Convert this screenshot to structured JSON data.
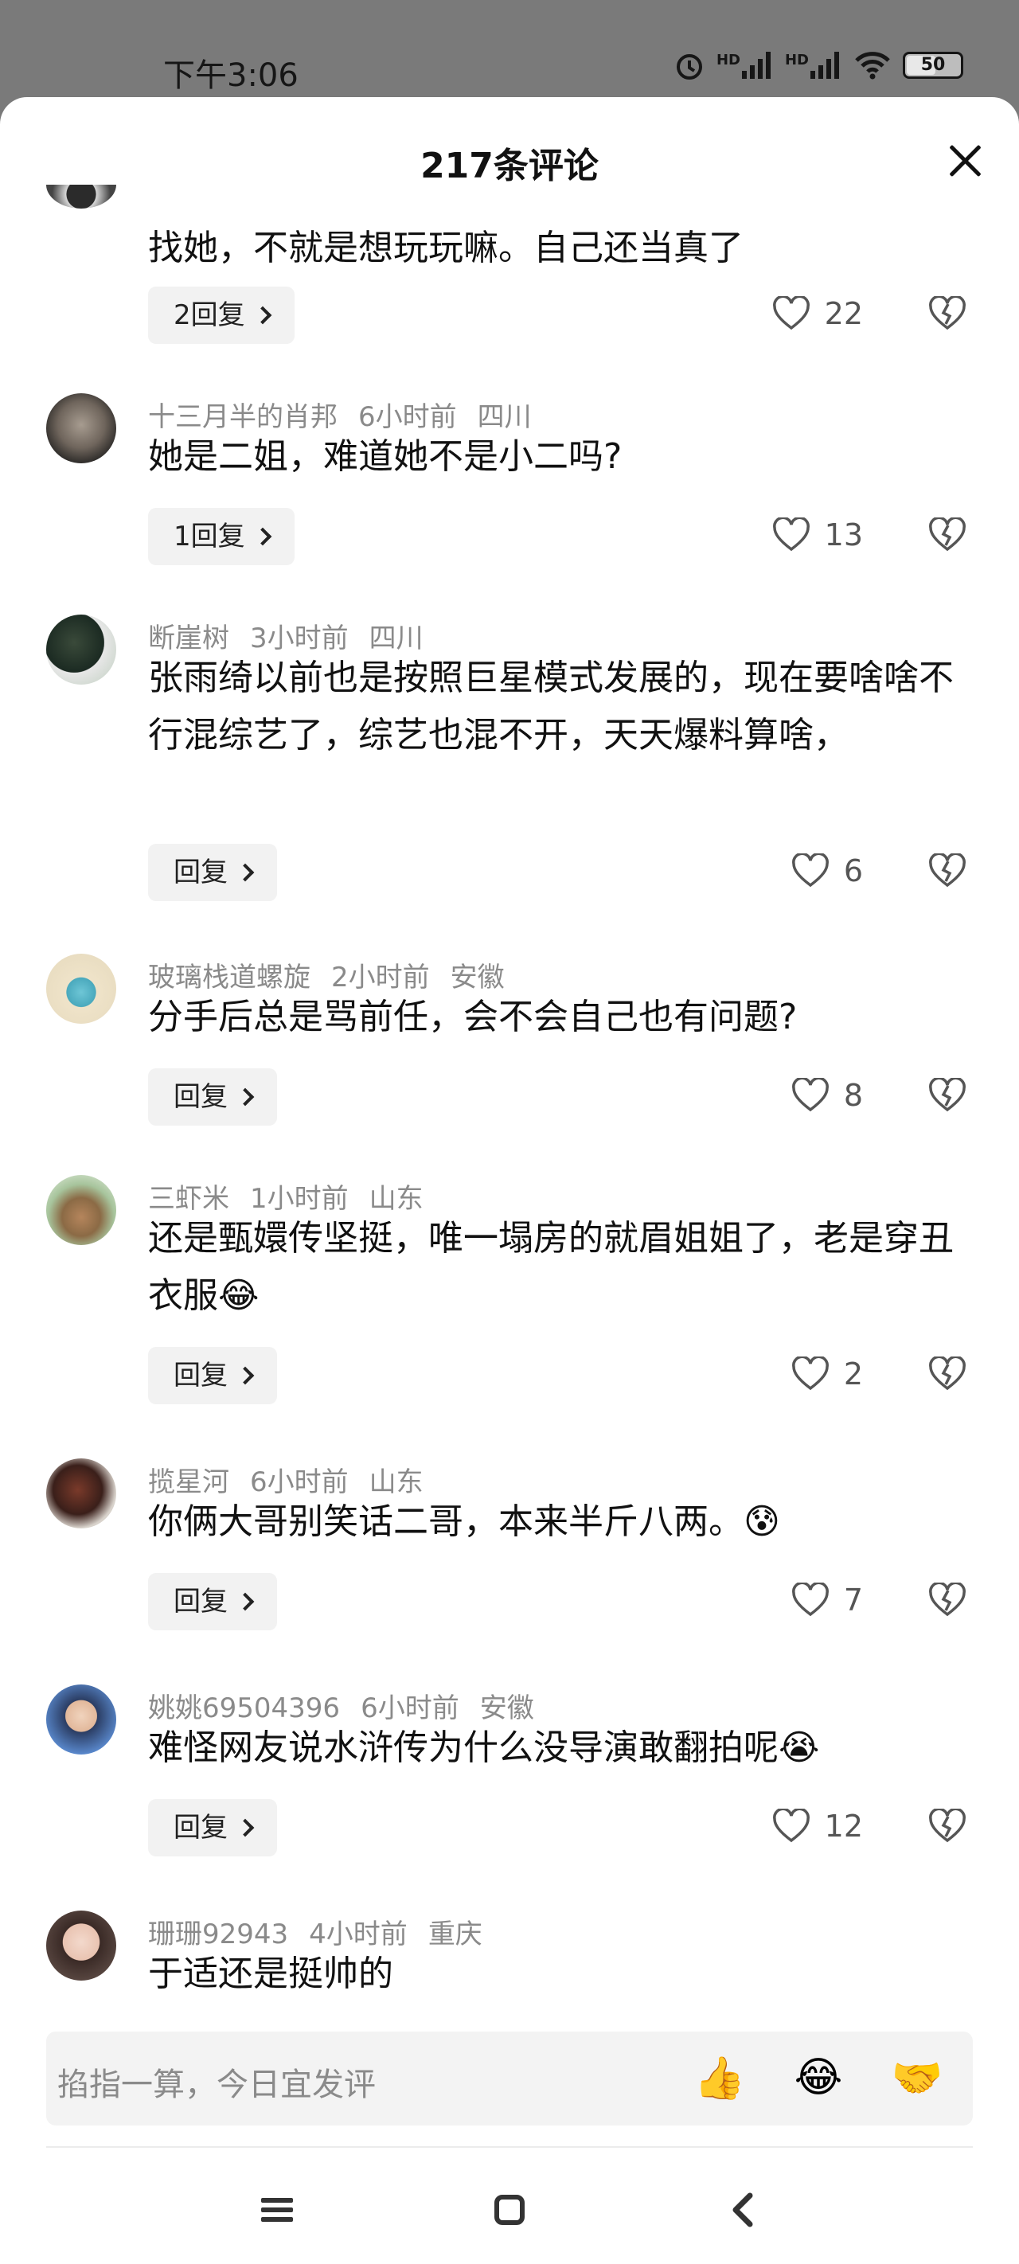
{
  "status_bar": {
    "time": "下午3:06",
    "battery": "50",
    "network_1": "HD",
    "network_2": "HD"
  },
  "header": {
    "title": "217条评论",
    "close_icon": "close-icon"
  },
  "colors": {
    "meta_text": "#8a8a8a",
    "reply_bg": "#f2f2f2",
    "sheet_bg": "#ffffff",
    "status_bg": "#7a7a7a"
  },
  "comments": [
    {
      "user": "",
      "time": "",
      "location": "",
      "text": "找她，不就是想玩玩嘛。自己还当真了",
      "reply_label": "2回复",
      "likes": "22"
    },
    {
      "user": "十三月半的肖邦",
      "time": "6小时前",
      "location": "四川",
      "text": "她是二姐，难道她不是小二吗?",
      "reply_label": "1回复",
      "likes": "13"
    },
    {
      "user": "断崖树",
      "time": "3小时前",
      "location": "四川",
      "text": "张雨绮以前也是按照巨星模式发展的，现在要啥啥不行混综艺了，综艺也混不开，天天爆料算啥，",
      "reply_label": "回复",
      "likes": "6"
    },
    {
      "user": "玻璃栈道螺旋",
      "time": "2小时前",
      "location": "安徽",
      "text": "分手后总是骂前任，会不会自己也有问题?",
      "reply_label": "回复",
      "likes": "8"
    },
    {
      "user": "三虾米",
      "time": "1小时前",
      "location": "山东",
      "text": "还是甄嬛传坚挺，唯一塌房的就眉姐姐了，老是穿丑衣服😂",
      "reply_label": "回复",
      "likes": "2"
    },
    {
      "user": "揽星河",
      "time": "6小时前",
      "location": "山东",
      "text": "你俩大哥别笑话二哥，本来半斤八两。😰",
      "reply_label": "回复",
      "likes": "7"
    },
    {
      "user": "姚姚69504396",
      "time": "6小时前",
      "location": "安徽",
      "text": "难怪网友说水浒传为什么没导演敢翻拍呢😭",
      "reply_label": "回复",
      "likes": "12"
    },
    {
      "user": "珊珊92943",
      "time": "4小时前",
      "location": "重庆",
      "text": "于适还是挺帅的",
      "reply_label": "",
      "likes": ""
    }
  ],
  "input_bar": {
    "placeholder": "掐指一算，今日宜发评",
    "emojis": [
      "👍",
      "😂",
      "🤝"
    ]
  },
  "nav_icons": [
    "menu-icon",
    "home-icon",
    "back-icon"
  ]
}
